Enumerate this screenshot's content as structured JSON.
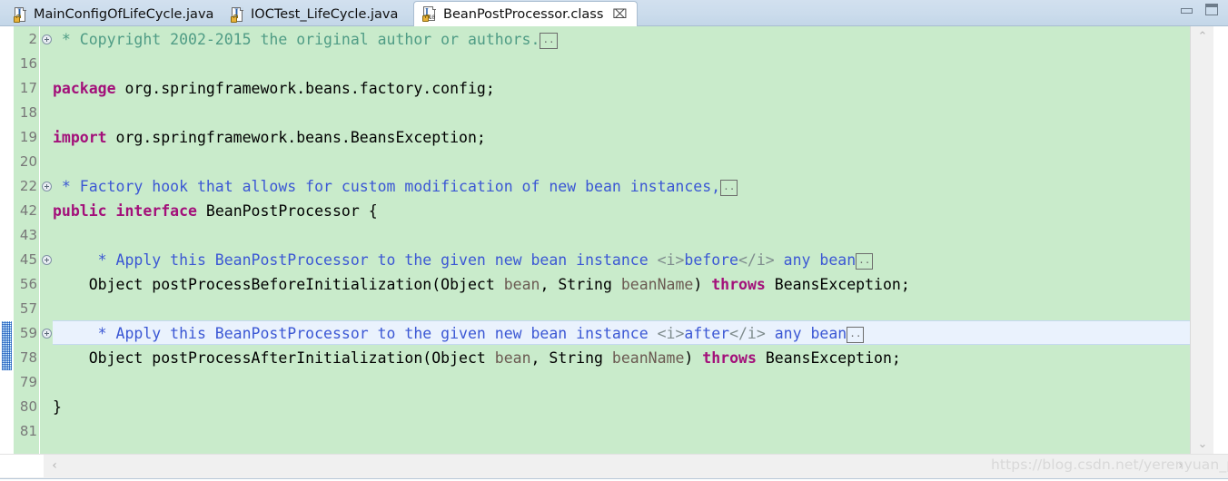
{
  "window": {
    "minimize_label": "minimize",
    "maximize_label": "maximize"
  },
  "tabs": [
    {
      "label": "MainConfigOfLifeCycle.java",
      "icon": "java-file-icon",
      "active": false,
      "closable": false
    },
    {
      "label": "IOCTest_LifeCycle.java",
      "icon": "java-file-icon",
      "active": false,
      "closable": false
    },
    {
      "label": "BeanPostProcessor.class",
      "icon": "class-file-icon",
      "active": true,
      "closable": true,
      "close_glyph": "⌧"
    }
  ],
  "editor": {
    "background_color": "#c9ebcb",
    "current_line_color": "#eaf2fd",
    "gutter": {
      "numbers": [
        "2",
        "16",
        "17",
        "18",
        "19",
        "20",
        "22",
        "42",
        "43",
        "45",
        "56",
        "57",
        "59",
        "78",
        "79",
        "80",
        "81"
      ],
      "fold_markers_on": [
        "2",
        "22",
        "45",
        "59"
      ],
      "fold_glyph": "⊕"
    },
    "change_marker": {
      "from_line": "59",
      "to_line": "78",
      "color": "#2d7fd3"
    },
    "fold_box_text": "..",
    "lines": [
      {
        "number": "2",
        "segments": [
          {
            "text": " * Copyright 2002-2015 the original author or authors.",
            "style": "cmt"
          },
          {
            "text": "..",
            "style": "foldbox"
          }
        ]
      },
      {
        "number": "16",
        "segments": []
      },
      {
        "number": "17",
        "segments": [
          {
            "text": "package",
            "style": "kw"
          },
          {
            "text": " org.springframework.beans.factory.config;",
            "style": "plain"
          }
        ]
      },
      {
        "number": "18",
        "segments": []
      },
      {
        "number": "19",
        "segments": [
          {
            "text": "import",
            "style": "kw"
          },
          {
            "text": " org.springframework.beans.BeansException;",
            "style": "plain"
          }
        ]
      },
      {
        "number": "20",
        "segments": []
      },
      {
        "number": "22",
        "segments": [
          {
            "text": " * Factory hook that allows for custom modification of new bean instances,",
            "style": "doc"
          },
          {
            "text": "..",
            "style": "foldbox"
          }
        ]
      },
      {
        "number": "42",
        "segments": [
          {
            "text": "public interface",
            "style": "kw"
          },
          {
            "text": " BeanPostProcessor {",
            "style": "plain"
          }
        ]
      },
      {
        "number": "43",
        "segments": []
      },
      {
        "number": "45",
        "segments": [
          {
            "text": "     * Apply this BeanPostProcessor to the given new bean instance ",
            "style": "doc"
          },
          {
            "text": "<i>",
            "style": "tag"
          },
          {
            "text": "before",
            "style": "doc"
          },
          {
            "text": "</i>",
            "style": "tag"
          },
          {
            "text": " any bean",
            "style": "doc"
          },
          {
            "text": "..",
            "style": "foldbox"
          }
        ]
      },
      {
        "number": "56",
        "segments": [
          {
            "text": "    Object postProcessBeforeInitialization(Object ",
            "style": "plain"
          },
          {
            "text": "bean",
            "style": "param"
          },
          {
            "text": ", String ",
            "style": "plain"
          },
          {
            "text": "beanName",
            "style": "param"
          },
          {
            "text": ") ",
            "style": "plain"
          },
          {
            "text": "throws",
            "style": "kw"
          },
          {
            "text": " BeansException;",
            "style": "plain"
          }
        ]
      },
      {
        "number": "57",
        "segments": []
      },
      {
        "number": "59",
        "current": true,
        "segments": [
          {
            "text": "     * Apply this BeanPostProcessor to the given new bean instance ",
            "style": "doc"
          },
          {
            "text": "<i>",
            "style": "tag"
          },
          {
            "text": "after",
            "style": "doc"
          },
          {
            "text": "</i>",
            "style": "tag"
          },
          {
            "text": " any bean",
            "style": "doc"
          },
          {
            "text": "..",
            "style": "foldbox"
          }
        ]
      },
      {
        "number": "78",
        "segments": [
          {
            "text": "    Object postProcessAfterInitialization(Object ",
            "style": "plain"
          },
          {
            "text": "bean",
            "style": "param"
          },
          {
            "text": ", String ",
            "style": "plain"
          },
          {
            "text": "beanName",
            "style": "param"
          },
          {
            "text": ") ",
            "style": "plain"
          },
          {
            "text": "throws",
            "style": "kw"
          },
          {
            "text": " BeansException;",
            "style": "plain"
          }
        ]
      },
      {
        "number": "79",
        "segments": []
      },
      {
        "number": "80",
        "segments": [
          {
            "text": "}",
            "style": "brace"
          }
        ]
      },
      {
        "number": "81",
        "segments": []
      }
    ]
  },
  "scrollbars": {
    "vertical": {
      "up_glyph": "⌃",
      "down_glyph": "⌄"
    },
    "horizontal": {
      "left_glyph": "‹",
      "right_glyph": "›"
    }
  },
  "watermark": {
    "text": "https://blog.csdn.net/yerenyuan_pku"
  }
}
